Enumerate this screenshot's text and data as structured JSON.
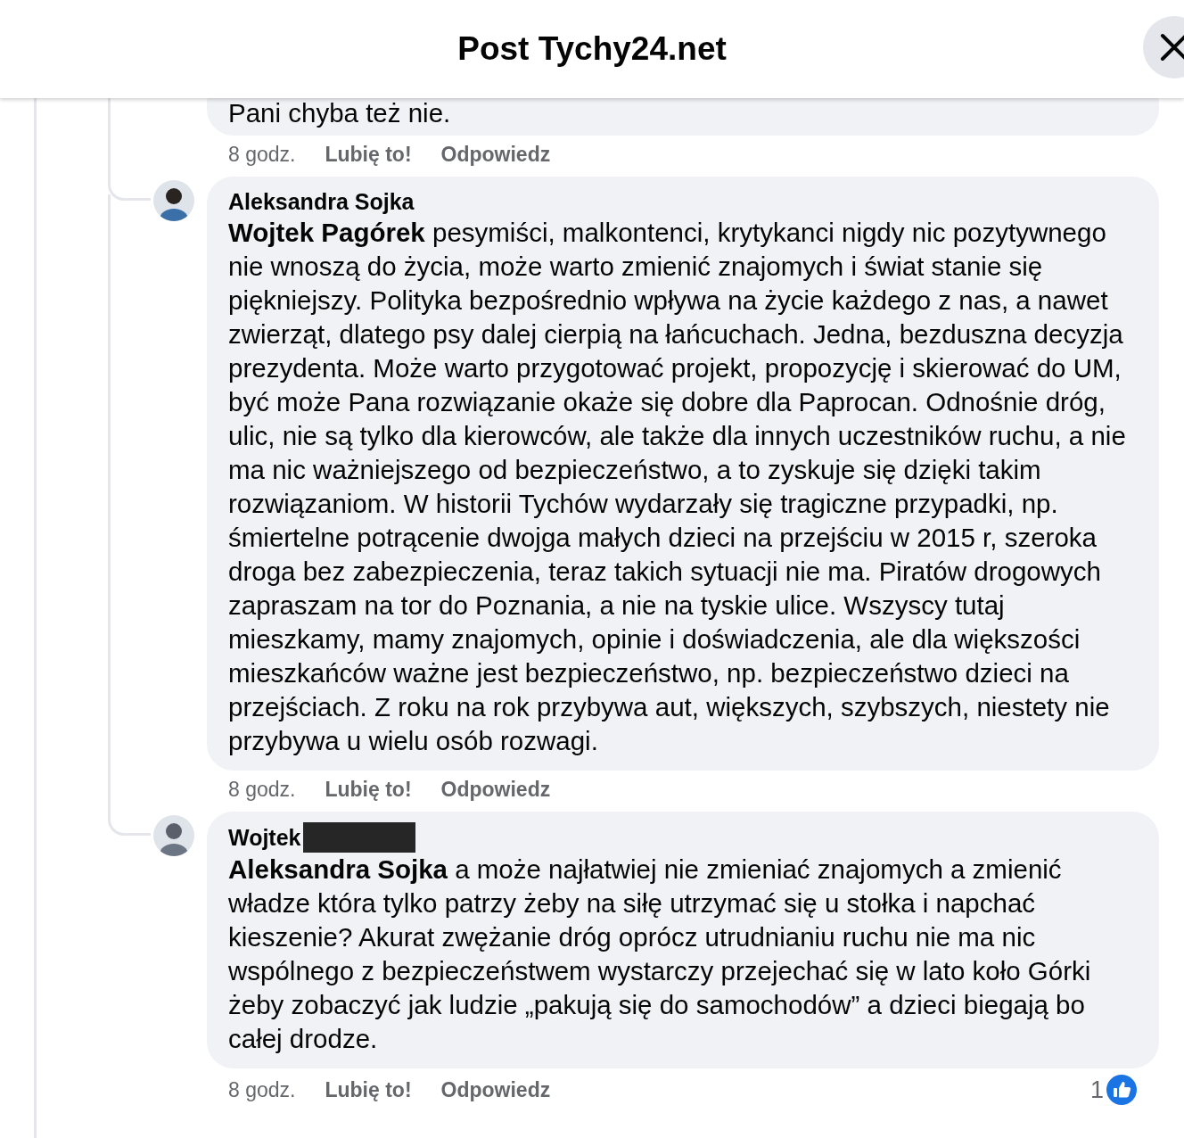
{
  "header": {
    "title": "Post Tychy24.net"
  },
  "comments": [
    {
      "kind": "partial",
      "text": "Pani chyba też nie.",
      "time": "8 godz.",
      "like": "Lubię to!",
      "reply": "Odpowiedz"
    },
    {
      "kind": "full",
      "author": "Aleksandra Sojka",
      "redacted": false,
      "text": "**Wojtek Pagórek** pesymiści, malkontenci, krytykanci nigdy nic pozytywnego nie wnoszą do życia, może warto zmienić znajomych i świat stanie się piękniejszy. Polityka bezpośrednio wpływa na życie każdego z nas, a nawet zwierząt, dlatego psy dalej cierpią na łańcuchach. Jedna, bezduszna decyzja prezydenta. Może warto przygotować projekt, propozycję i skierować do UM, być może Pana rozwiązanie okaże się dobre dla Paprocan. Odnośnie dróg, ulic, nie są tylko dla kierowców, ale także dla innych uczestników ruchu, a nie ma nic ważniejszego od bezpieczeństwo, a to zyskuje się dzięki takim rozwiązaniom. W historii Tychów wydarzały się tragiczne przypadki, np. śmiertelne potrącenie dwojga małych dzieci na przejściu w 2015 r, szeroka droga bez zabezpieczenia, teraz takich sytuacji nie ma. Piratów drogowych zapraszam na tor do Poznania, a nie na tyskie ulice. Wszyscy tutaj mieszkamy, mamy znajomych, opinie i doświadczenia, ale dla większości mieszkańców ważne jest bezpieczeństwo, np. bezpieczeństwo dzieci na przejściach. Z roku na rok przybywa aut, większych, szybszych, niestety nie przybywa u wielu osób rozwagi.",
      "time": "8 godz.",
      "like": "Lubię to!",
      "reply": "Odpowiedz"
    },
    {
      "kind": "full",
      "author": "Wojtek",
      "redacted": true,
      "text": "**Aleksandra Sojka** a może najłatwiej nie zmieniać znajomych a zmienić władze która tylko patrzy żeby na siłę utrzymać się u stołka i napchać kieszenie? Akurat zwężanie dróg oprócz utrudnianiu ruchu nie ma nic wspólnego z bezpieczeństwem wystarczy przejechać się w lato koło Górki żeby zobaczyć jak ludzie „pakują się do samochodów” a dzieci biegają bo całej drodze.",
      "time": "8 godz.",
      "like": "Lubię to!",
      "reply": "Odpowiedz",
      "reactions": "1"
    }
  ]
}
